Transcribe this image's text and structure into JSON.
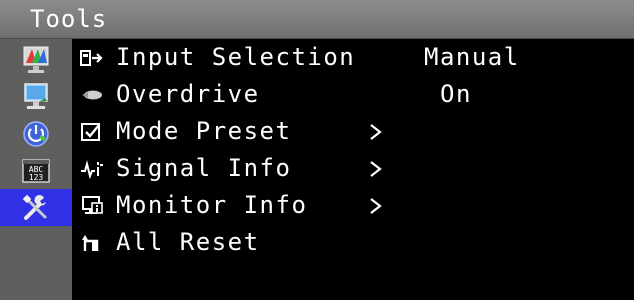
{
  "window": {
    "title": "Tools"
  },
  "sidebar": {
    "items": [
      {
        "icon": "color-adjust-icon",
        "active": false
      },
      {
        "icon": "screen-settings-icon",
        "active": false
      },
      {
        "icon": "power-eco-icon",
        "active": false
      },
      {
        "icon": "language-abc-123-icon",
        "active": false,
        "text_top": "ABC",
        "text_bottom": "123"
      },
      {
        "icon": "tools-icon",
        "active": true
      }
    ]
  },
  "menu": {
    "items": [
      {
        "icon": "input-selection-icon",
        "label": "Input Selection",
        "value": "Manual"
      },
      {
        "icon": "overdrive-icon",
        "label": "Overdrive",
        "value": "On"
      },
      {
        "icon": "mode-preset-icon",
        "label": "Mode Preset",
        "arrow": ">"
      },
      {
        "icon": "signal-info-icon",
        "label": "Signal Info",
        "arrow": ">"
      },
      {
        "icon": "monitor-info-icon",
        "label": "Monitor Info",
        "arrow": ">"
      },
      {
        "icon": "all-reset-icon",
        "label": "All Reset"
      }
    ]
  },
  "colors": {
    "title_bar": "#7d7d7d",
    "sidebar": "#5f5f5f",
    "active_highlight": "#3030e6",
    "background": "#000000",
    "text": "#ffffff"
  }
}
